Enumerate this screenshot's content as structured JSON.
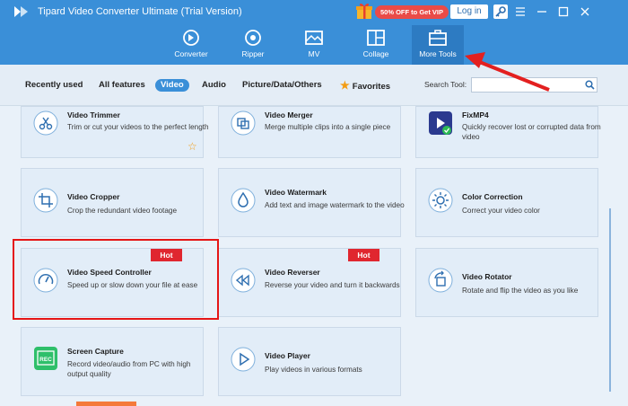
{
  "app": {
    "title": "Tipard Video Converter Ultimate (Trial Version)"
  },
  "topbar": {
    "promo": "50% OFF to Get VIP",
    "login": "Log in",
    "icons": [
      "logo-icon",
      "gift-icon",
      "key-icon",
      "menu-icon",
      "minimize-icon",
      "maximize-icon",
      "close-icon"
    ]
  },
  "nav": [
    {
      "label": "Converter"
    },
    {
      "label": "Ripper"
    },
    {
      "label": "MV"
    },
    {
      "label": "Collage"
    },
    {
      "label": "More Tools"
    }
  ],
  "filters": {
    "items": [
      "Recently used",
      "All features",
      "Video",
      "Audio",
      "Picture/Data/Others",
      "Favorites"
    ],
    "active": "Video",
    "search_label": "Search Tool:",
    "search_placeholder": ""
  },
  "tools": [
    {
      "title": "Video Trimmer",
      "desc": "Trim or cut your videos to the perfect length"
    },
    {
      "title": "Video Merger",
      "desc": "Merge multiple clips into a single piece"
    },
    {
      "title": "FixMP4",
      "desc": "Quickly recover lost or corrupted data from video"
    },
    {
      "title": "Video Cropper",
      "desc": "Crop the redundant video footage"
    },
    {
      "title": "Video Watermark",
      "desc": "Add text and image watermark to the video"
    },
    {
      "title": "Color Correction",
      "desc": "Correct your video color"
    },
    {
      "title": "Video Speed Controller",
      "desc": "Speed up or slow down your file at ease",
      "badge": "Hot"
    },
    {
      "title": "Video Reverser",
      "desc": "Reverse your video and turn it backwards",
      "badge": "Hot"
    },
    {
      "title": "Video Rotator",
      "desc": "Rotate and flip the video as you like"
    },
    {
      "title": "Screen Capture",
      "desc": "Record video/audio from PC with high output quality",
      "icon_text": "REC"
    },
    {
      "title": "Video Player",
      "desc": "Play videos in various formats"
    }
  ],
  "colors": {
    "accent": "#3a8fd8",
    "hot": "#e0262f",
    "highlight": "#e51616",
    "favorite": "#f39c12"
  }
}
